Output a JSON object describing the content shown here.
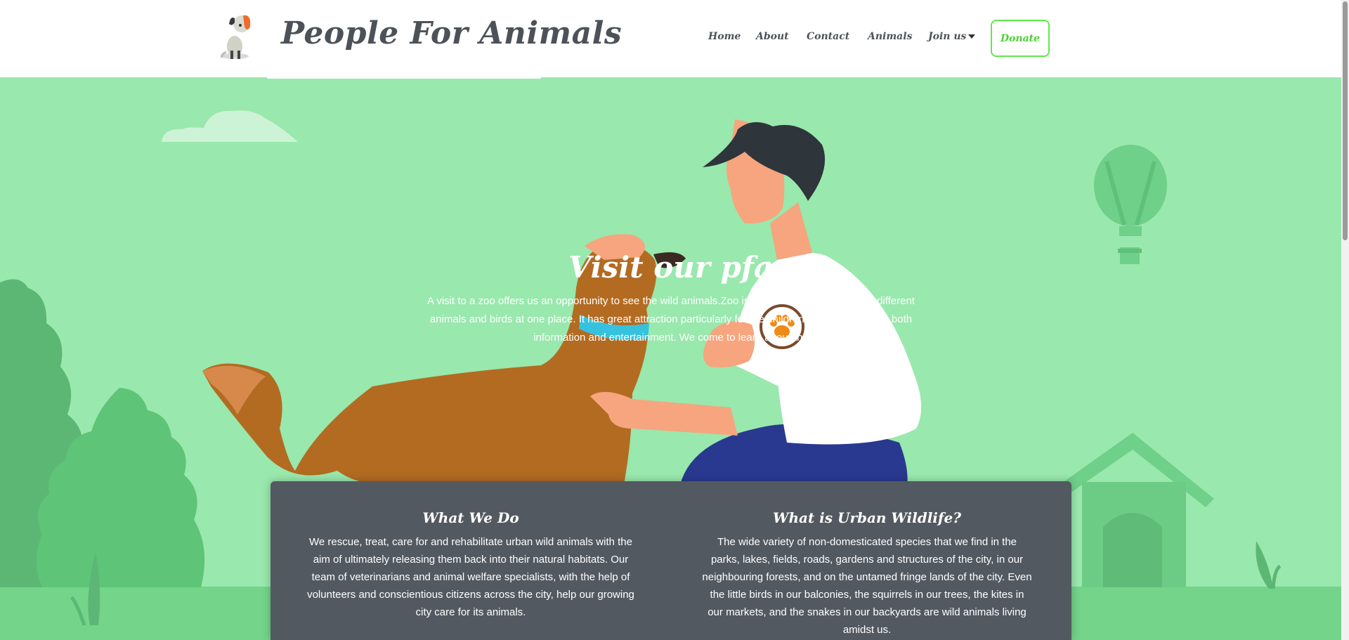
{
  "brand": {
    "name": "People For Animals"
  },
  "nav": {
    "home": "Home",
    "about": "About",
    "contact": "Contact",
    "animals": "Animals",
    "join": "Join us",
    "donate": "Donate"
  },
  "hero": {
    "title": "Visit our pfa",
    "text": "A visit to a zoo offers us an opportunity to see the wild animals.Zoo is a place where we can see different animals and birds at one place. It has great attraction particularly for the children and also gives us both information and entertainment. We come to learn about the"
  },
  "sections": [
    {
      "title": "What We Do",
      "text": "We rescue, treat, care for and rehabilitate urban wild animals with the aim of ultimately releasing them back into their natural habitats. Our team of veterinarians and animal welfare specialists, with the help of volunteers and conscientious citizens across the city, help our growing city care for its animals."
    },
    {
      "title": "What is Urban Wildlife?",
      "text": "The wide variety of non-domesticated species that we find in the parks, lakes, fields, roads, gardens and structures of the city, in our neighbouring forests, and on the untamed fringe lands of the city. Even the little birds in our balconies, the squirrels in our trees, the kites in our markets, and the snakes in our backyards are wild animals living amidst us."
    }
  ],
  "colors": {
    "background": "#99e8ad",
    "panel": "#535961",
    "accent": "#5ee84a",
    "text_dark": "#4d5259"
  },
  "icons": {
    "logo": "dog-logo-icon",
    "caret": "caret-down-icon",
    "paw": "paw-icon"
  }
}
